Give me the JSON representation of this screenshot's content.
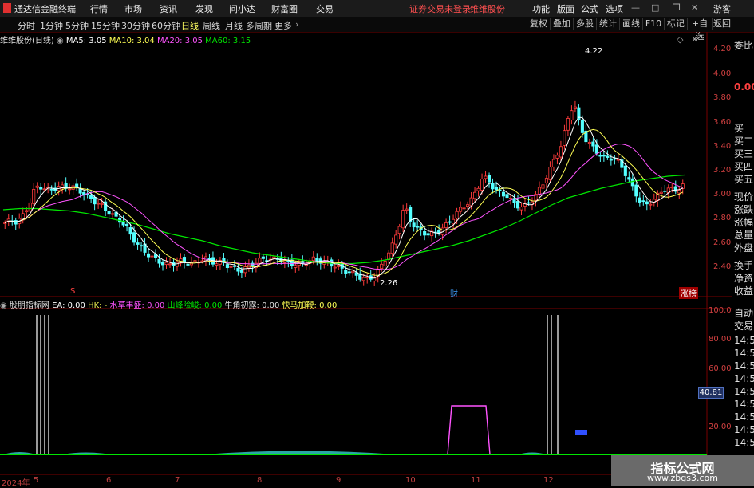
{
  "topbar": {
    "app_title": "通达信金融终端",
    "menu": [
      "行情",
      "市场",
      "资讯",
      "发现",
      "问小达",
      "财富圈",
      "交易"
    ],
    "notice": "证券交易未登录",
    "stock_link": "维维股份",
    "right_menu": [
      "功能",
      "版面",
      "公式",
      "选项"
    ],
    "guest": "游客"
  },
  "timeframes": [
    "分时",
    "1分钟",
    "5分钟",
    "15分钟",
    "30分钟",
    "60分钟",
    "日线",
    "周线",
    "月线",
    "多周期",
    "更多"
  ],
  "active_timeframe": "日线",
  "tools": [
    "复权",
    "叠加",
    "多股",
    "统计",
    "画线",
    "F10",
    "标记",
    "+自选",
    "返回"
  ],
  "chart_header": {
    "stock": "维维股份(日线)",
    "ma5": "MA5: 3.05",
    "ma10": "MA10: 3.04",
    "ma20": "MA20: 3.05",
    "ma60": "MA60: 3.15"
  },
  "indicator_header": {
    "name": "股朋指标网",
    "ea": "EA: 0.00",
    "hk": "HK: -",
    "s1": "水草丰盛: 0.00",
    "s2": "山峰险峻: 0.00",
    "s3": "牛角初露: 0.00",
    "s4": "快马加鞭: 0.00"
  },
  "price_axis": [
    "4.20",
    "4.00",
    "3.80",
    "3.60",
    "3.40",
    "3.20",
    "3.00",
    "2.80",
    "2.60",
    "2.40"
  ],
  "ind_axis": [
    "100.00",
    "80.00",
    "60.00",
    "40.00",
    "20.00"
  ],
  "ind_value_box": "40.81",
  "markers": {
    "high": "4.22",
    "low": "2.26",
    "s": "S",
    "cai": "财",
    "zhang": "涨榜"
  },
  "date_axis": [
    "2024年",
    "5",
    "6",
    "7",
    "8",
    "9",
    "10",
    "11",
    "12"
  ],
  "side_panel": [
    "委比",
    "",
    "买一",
    "买二",
    "买三",
    "买四",
    "买五",
    "现价",
    "涨跌",
    "涨幅",
    "总量",
    "外盘",
    "换手",
    "净资",
    "收益"
  ],
  "side_panel2": [
    "自动",
    "交易",
    "14:56",
    "14:56",
    "14:56",
    "14:56",
    "14:56",
    "14:56",
    "14:56",
    "14:56",
    "14:56"
  ],
  "side_big": "0.00",
  "watermark": {
    "line1": "指标公式网",
    "line2": "www.zbgs3.com"
  },
  "colors": {
    "up": "#ff3b3b",
    "down": "#54ffff",
    "ma5": "#ffffff",
    "ma10": "#ffff54",
    "ma20": "#ff54ff",
    "ma60": "#00e600",
    "axis": "#a00000"
  },
  "chart_data": {
    "type": "candlestick",
    "title": "维维股份(日线)",
    "ylim": [
      2.2,
      4.3
    ],
    "x": [
      "2024-04",
      "2024-05",
      "2024-06",
      "2024-07",
      "2024-08",
      "2024-09",
      "2024-10",
      "2024-11",
      "2024-12"
    ],
    "close_path": [
      2.75,
      2.76,
      2.74,
      2.8,
      2.9,
      3.05,
      3.06,
      3.04,
      3.05,
      3.06,
      3.05,
      3.04,
      3.02,
      2.98,
      2.95,
      2.92,
      2.9,
      2.86,
      2.82,
      2.78,
      2.72,
      2.62,
      2.55,
      2.5,
      2.46,
      2.44,
      2.42,
      2.41,
      2.43,
      2.44,
      2.42,
      2.4,
      2.42,
      2.44,
      2.42,
      2.41,
      2.43,
      2.4,
      2.38,
      2.36,
      2.38,
      2.4,
      2.42,
      2.44,
      2.43,
      2.45,
      2.44,
      2.42,
      2.42,
      2.41,
      2.43,
      2.44,
      2.42,
      2.4,
      2.39,
      2.38,
      2.36,
      2.35,
      2.33,
      2.3,
      2.28,
      2.3,
      2.36,
      2.45,
      2.55,
      2.7,
      2.9,
      2.78,
      2.72,
      2.68,
      2.66,
      2.66,
      2.68,
      2.72,
      2.78,
      2.85,
      2.9,
      2.95,
      3.05,
      3.15,
      3.1,
      3.02,
      2.98,
      2.96,
      2.9,
      2.88,
      2.9,
      2.95,
      3.02,
      3.1,
      3.2,
      3.3,
      3.4,
      3.6,
      3.75,
      3.55,
      3.45,
      3.4,
      3.35,
      3.3,
      3.3,
      3.28,
      3.2,
      3.1,
      3.0,
      2.92,
      2.9,
      2.95,
      3.0,
      3.05,
      3.04,
      3.02,
      3.05
    ],
    "ma60_path": [
      2.86,
      2.87,
      2.87,
      2.86,
      2.85,
      2.83,
      2.8,
      2.77,
      2.74,
      2.7,
      2.66,
      2.63,
      2.6,
      2.56,
      2.53,
      2.5,
      2.48,
      2.46,
      2.44,
      2.42,
      2.41,
      2.41,
      2.42,
      2.44,
      2.47,
      2.5,
      2.53,
      2.56,
      2.6,
      2.65,
      2.7,
      2.76,
      2.83,
      2.9,
      2.96,
      3.0,
      3.04,
      3.07,
      3.1,
      3.12,
      3.14,
      3.15
    ]
  }
}
